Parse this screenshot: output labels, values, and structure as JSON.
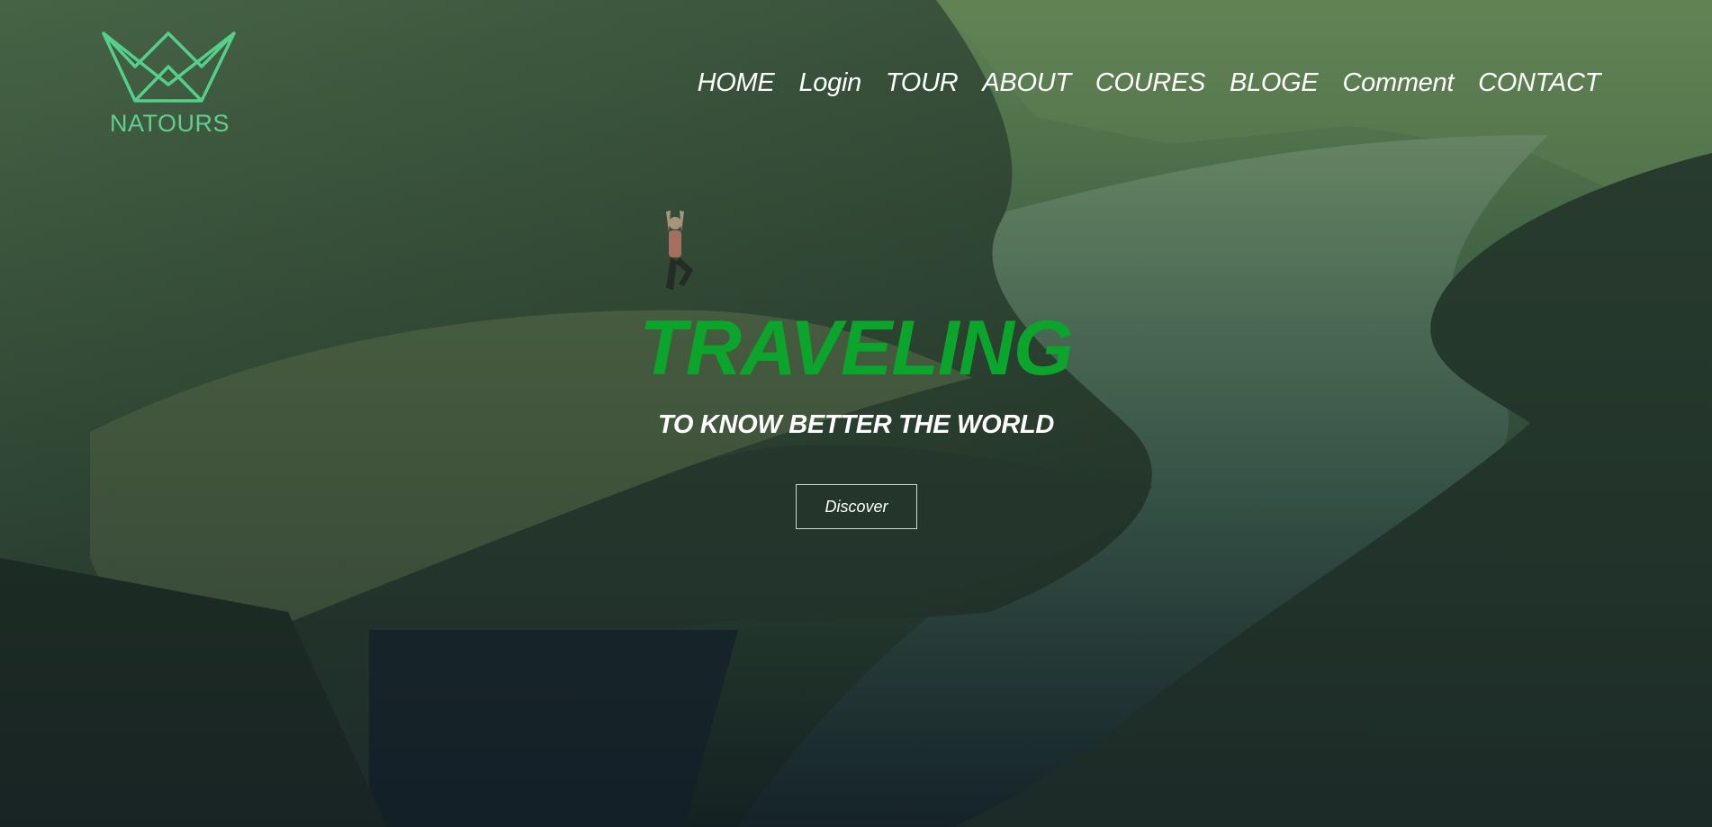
{
  "brand": {
    "name": "NATOURS",
    "logo_icon": "crown-icon",
    "accent_color": "#5fcf8a"
  },
  "nav": {
    "items": [
      {
        "label": "HOME"
      },
      {
        "label": "Login"
      },
      {
        "label": "TOUR"
      },
      {
        "label": "ABOUT"
      },
      {
        "label": "COURES"
      },
      {
        "label": "BLOGE"
      },
      {
        "label": "Comment"
      },
      {
        "label": "CONTACT"
      }
    ]
  },
  "hero": {
    "title": "TRAVELING",
    "title_color": "#0aa52a",
    "subtitle": "TO KNOW BETTER THE WORLD",
    "cta_label": "Discover"
  }
}
